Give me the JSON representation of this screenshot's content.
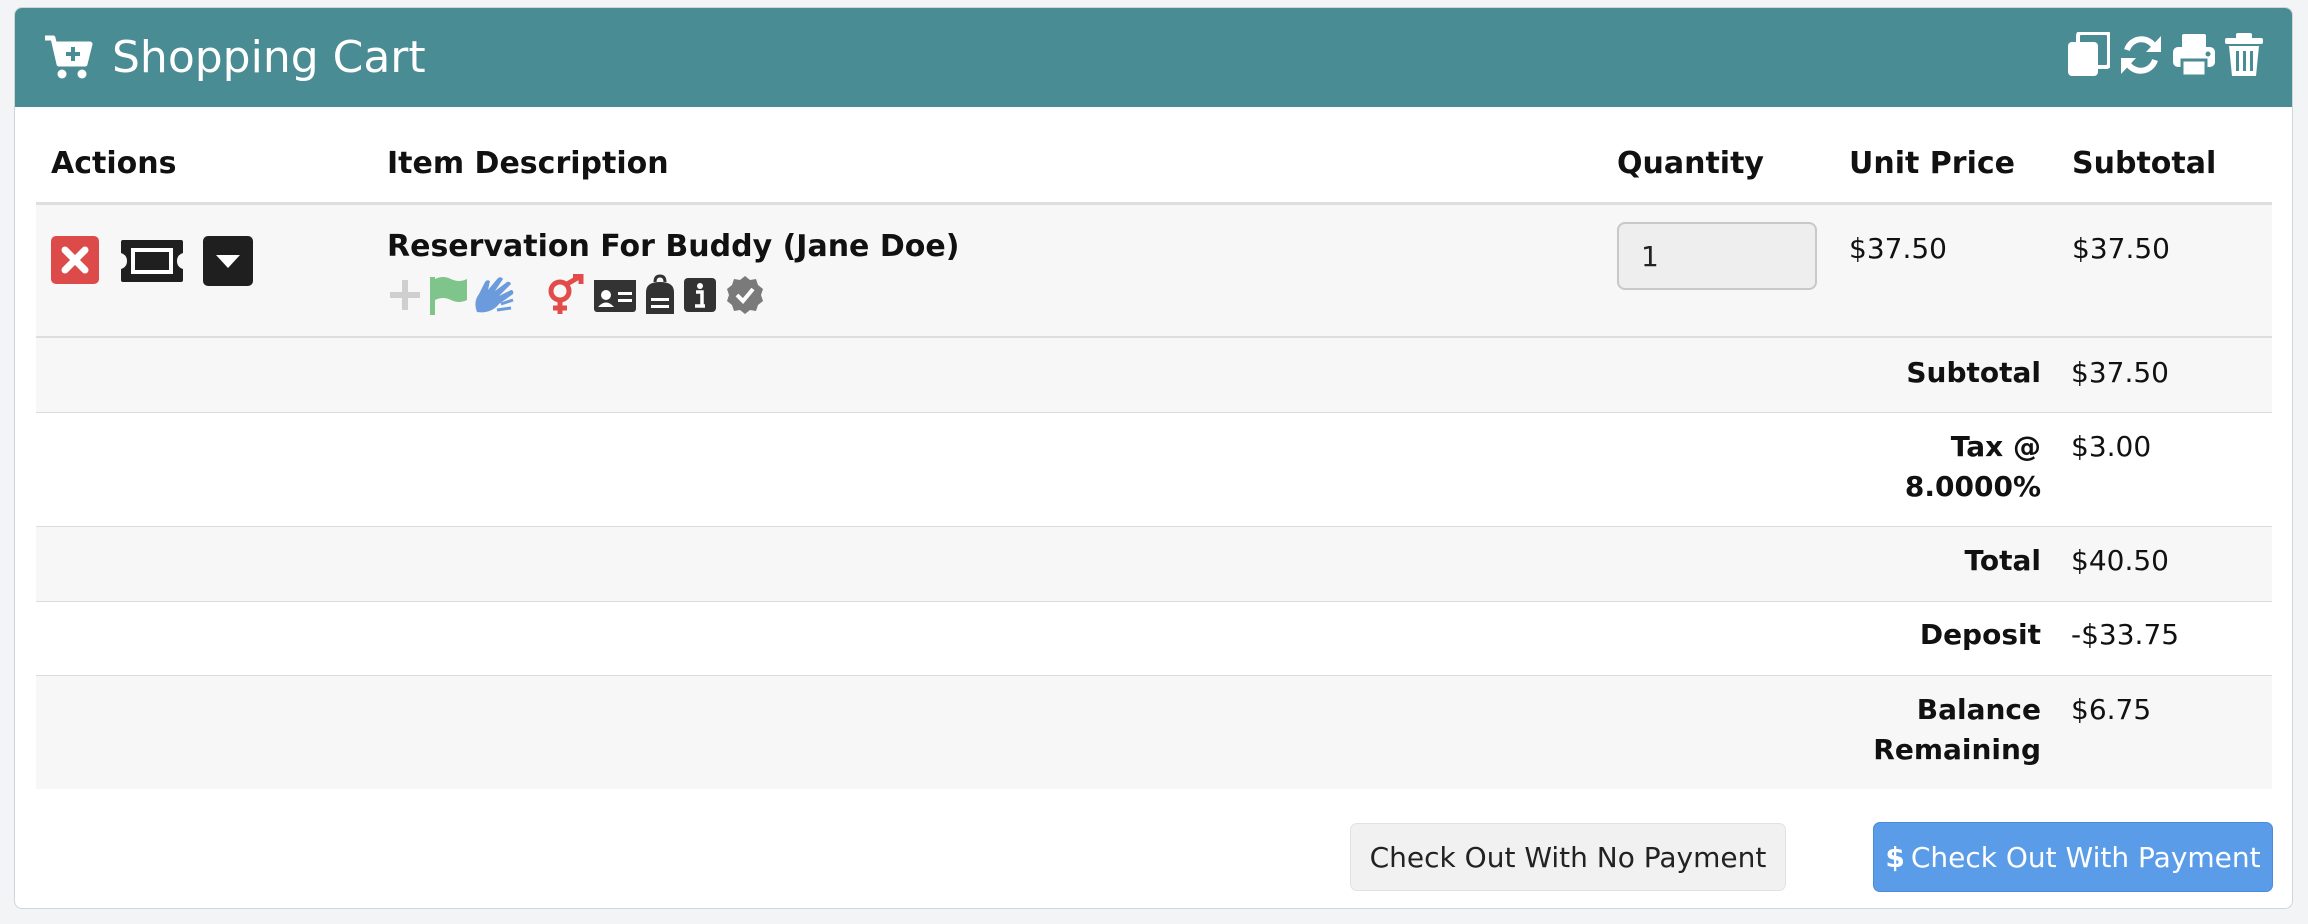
{
  "header": {
    "title": "Shopping Cart",
    "icons": [
      "cart-plus-icon",
      "copy-icon",
      "refresh-icon",
      "print-icon",
      "trash-icon"
    ],
    "background_color": "#4a8c93"
  },
  "table": {
    "columns": {
      "actions": "Actions",
      "description": "Item Description",
      "quantity": "Quantity",
      "unit_price": "Unit Price",
      "subtotal": "Subtotal"
    },
    "rows": [
      {
        "description": "Reservation For Buddy (Jane Doe)",
        "quantity": "1",
        "unit_price": "$37.50",
        "subtotal": "$37.50",
        "action_icons": [
          "remove-icon",
          "ticket-icon",
          "dropdown-caret-icon"
        ],
        "status_icons": [
          "plus-icon",
          "flag-icon",
          "sign-language-icon",
          "gender-icon",
          "id-card-icon",
          "backpack-icon",
          "info-icon",
          "verified-badge-icon"
        ]
      }
    ]
  },
  "summary": {
    "subtotal_label": "Subtotal",
    "subtotal_value": "$37.50",
    "tax_label_line1": "Tax @",
    "tax_label_line2": "8.0000%",
    "tax_value": "$3.00",
    "total_label": "Total",
    "total_value": "$40.50",
    "deposit_label": "Deposit",
    "deposit_value": "-$33.75",
    "balance_label_line1": "Balance",
    "balance_label_line2": "Remaining",
    "balance_value": "$6.75"
  },
  "buttons": {
    "checkout_no_payment": "Check Out With No Payment",
    "checkout_with_payment_symbol": "$",
    "checkout_with_payment": "Check Out With Payment"
  },
  "colors": {
    "remove": "#dc4a4a",
    "primary": "#5b9ce8",
    "flag": "#7fc48b",
    "sign_language": "#6b9bdc",
    "gender": "#e34b4b"
  }
}
